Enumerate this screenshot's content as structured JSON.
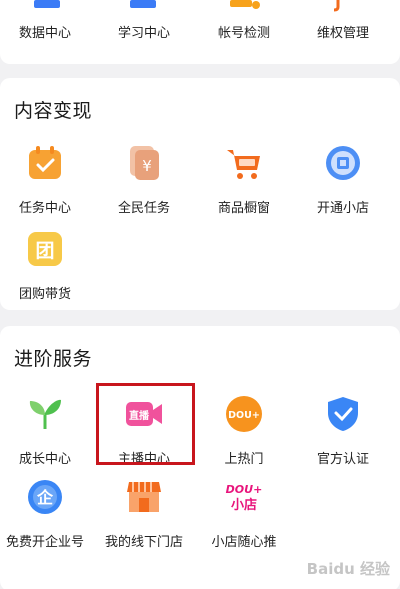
{
  "top_row": {
    "items": [
      {
        "label": "数据中心",
        "icon": "data-center-icon",
        "color": "#3b7bf6"
      },
      {
        "label": "学习中心",
        "icon": "learning-center-icon",
        "color": "#3b7bf6"
      },
      {
        "label": "帐号检测",
        "icon": "account-check-icon",
        "color": "#f7a21b"
      },
      {
        "label": "维权管理",
        "icon": "rights-management-icon",
        "color": "#f26b1d"
      }
    ]
  },
  "content_monetization": {
    "title": "内容变现",
    "items": [
      {
        "label": "任务中心",
        "icon": "task-center-icon",
        "color": "#f7a233"
      },
      {
        "label": "全民任务",
        "icon": "public-task-icon",
        "color": "#e8a17b"
      },
      {
        "label": "商品橱窗",
        "icon": "shopping-cart-icon",
        "color": "#f26b1d"
      },
      {
        "label": "开通小店",
        "icon": "open-shop-icon",
        "color": "#4d8ff5"
      },
      {
        "label": "团购带货",
        "icon": "group-buy-icon",
        "color": "#f7c948"
      }
    ]
  },
  "advanced_services": {
    "title": "进阶服务",
    "items": [
      {
        "label": "成长中心",
        "icon": "growth-sprout-icon",
        "color": "#4fc04e"
      },
      {
        "label": "主播中心",
        "icon": "live-camera-icon",
        "color": "#f0529c",
        "badge": "直播"
      },
      {
        "label": "上热门",
        "icon": "dou-plus-icon",
        "color": "#f7931e",
        "badge": "DOU+"
      },
      {
        "label": "官方认证",
        "icon": "verified-shield-icon",
        "color": "#3a86f5"
      },
      {
        "label": "免费开企业号",
        "icon": "enterprise-icon",
        "color": "#3a86f5",
        "badge": "企"
      },
      {
        "label": "我的线下门店",
        "icon": "store-front-icon",
        "color": "#f26b1d"
      },
      {
        "label": "小店随心推",
        "icon": "shop-promote-icon",
        "color": "#e8157c",
        "badge_line1": "DOU+",
        "badge_line2": "小店"
      }
    ]
  },
  "watermark": "Baidu 经验"
}
